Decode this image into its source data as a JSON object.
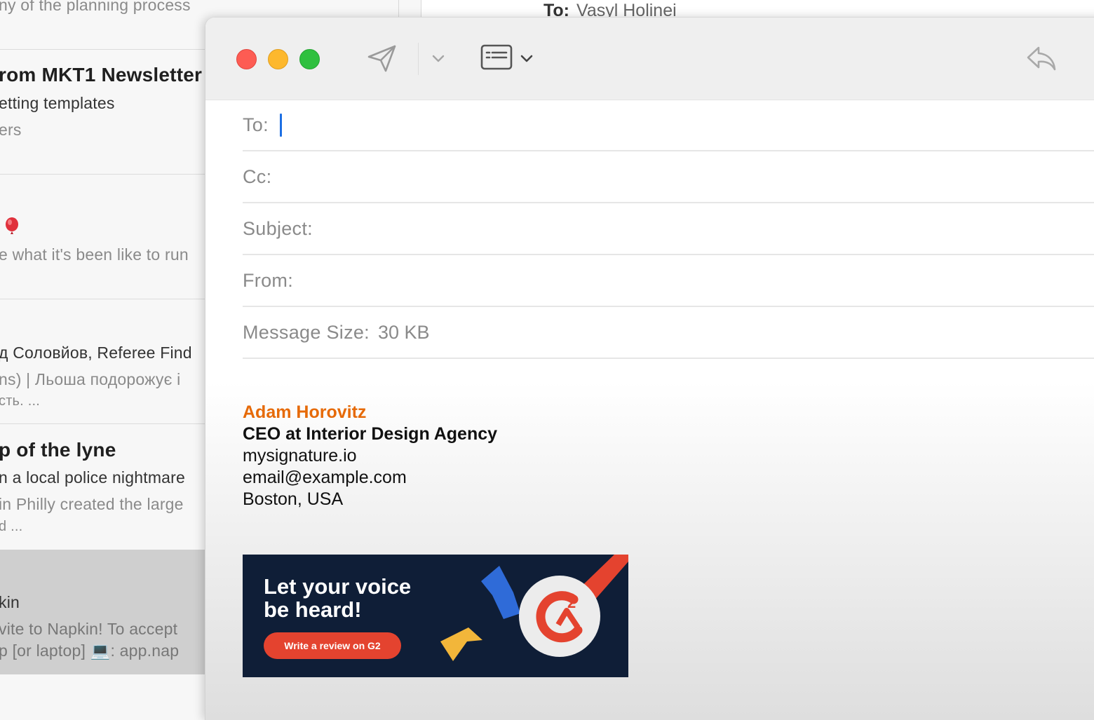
{
  "background_list": {
    "lines": [
      {
        "text": "ny of the planning process",
        "style": "light"
      },
      {
        "text": "rom MKT1 Newsletter",
        "style": "bold"
      },
      {
        "text": "etting templates",
        "style": "med"
      },
      {
        "text": "ers",
        "style": "light"
      },
      {
        "text": "e what it's been like to run",
        "style": "light"
      },
      {
        "text": "д Соловйов, Referee Find",
        "style": "med"
      },
      {
        "text": "ns) | Льоша подорожує і",
        "style": "light"
      },
      {
        "text": "сть. ...",
        "style": "light"
      },
      {
        "text": "p of the lyne",
        "style": "bold"
      },
      {
        "text": "n a local police nightmare",
        "style": "med"
      },
      {
        "text": "in Philly created the large",
        "style": "light"
      },
      {
        "text": "d ...",
        "style": "light"
      },
      {
        "text": "kin",
        "style": "med"
      },
      {
        "text": "vite to Napkin! To accept",
        "style": "light"
      },
      {
        "text": "p [or laptop] 💻: app.nap",
        "style": "light"
      }
    ],
    "header_to_label": "To:",
    "header_to_value": "Vasyl Holinei"
  },
  "compose": {
    "toolbar": {
      "send_icon": "paper-plane-icon",
      "send_dropdown_icon": "chevron-down-icon",
      "format_icon": "header-fields-icon",
      "format_dropdown_icon": "chevron-down-icon",
      "reply_icon": "reply-arrow-icon"
    },
    "fields": {
      "to_label": "To:",
      "cc_label": "Cc:",
      "subject_label": "Subject:",
      "from_label": "From:",
      "size_label": "Message Size:",
      "size_value": "30 KB"
    },
    "signature": {
      "name": "Adam Horovitz",
      "title": "CEO at Interior Design Agency",
      "website": "mysignature.io",
      "email": "email@example.com",
      "location": "Boston, USA"
    },
    "banner": {
      "headline_line1": "Let your voice",
      "headline_line2": "be heard!",
      "button_label": "Write a review on G2",
      "logo_text": "G",
      "logo_superscript": "2"
    }
  },
  "colors": {
    "close": "#fd5c53",
    "minimize": "#fdb82d",
    "zoom": "#2fc03f",
    "caret": "#1d6fe3",
    "signature_name": "#e66a08",
    "banner_bg": "#0f1e37",
    "banner_button": "#e4432f"
  }
}
